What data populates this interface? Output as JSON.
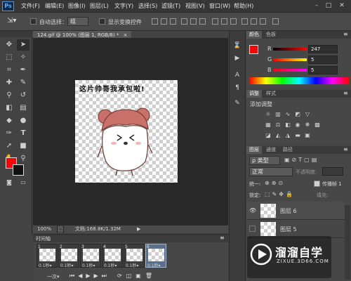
{
  "menubar": {
    "logo": "Ps",
    "items": [
      "文件(F)",
      "编辑(E)",
      "图像(I)",
      "图层(L)",
      "文字(Y)",
      "选择(S)",
      "滤镜(T)",
      "视图(V)",
      "窗口(W)",
      "帮助(H)"
    ],
    "window_controls": [
      "–",
      "□",
      "✕"
    ]
  },
  "options": {
    "auto_select_label": "自动选择：",
    "auto_select_value": "组",
    "show_transform_label": "显示变换控件"
  },
  "document": {
    "tab_title": "124.gif @ 100% (图层 1, RGB/8) *",
    "image_caption": "这片帅哥我承包啦!",
    "zoom": "100%",
    "doc_info": "文档:168.8K/1.32M"
  },
  "timeline": {
    "title": "时间轴",
    "frames": [
      {
        "num": "1",
        "delay": "0.1秒▾"
      },
      {
        "num": "2",
        "delay": "0.1秒▾"
      },
      {
        "num": "3",
        "delay": "0.1秒▾"
      },
      {
        "num": "4",
        "delay": "0.1秒▾"
      },
      {
        "num": "5",
        "delay": "0.1秒▾"
      },
      {
        "num": "6",
        "delay": "0.1秒▾"
      }
    ],
    "loop": "一次"
  },
  "color_panel": {
    "tabs": [
      "颜色",
      "色板"
    ],
    "r_label": "R",
    "g_label": "G",
    "b_label": "B",
    "r": "247",
    "g": "5",
    "b": "5",
    "foreground": "#f70505"
  },
  "adjust_panel": {
    "tabs": [
      "调整",
      "样式"
    ],
    "title": "添加调整"
  },
  "layers_panel": {
    "tabs": [
      "图层",
      "通道",
      "路径"
    ],
    "kind_filter": "ρ 类型",
    "blend_mode": "正常",
    "opacity_label": "不透明度:",
    "unify_label": "统一:",
    "propagate_label": "传播帧 1",
    "lock_label": "锁定:",
    "fill_label": "填充:",
    "layers": [
      {
        "name": "图层 6",
        "visible": true
      },
      {
        "name": "图层 5",
        "visible": false
      }
    ]
  },
  "watermark": {
    "brand": "溜溜自学",
    "url": "ZIXUE.3D66.COM"
  }
}
